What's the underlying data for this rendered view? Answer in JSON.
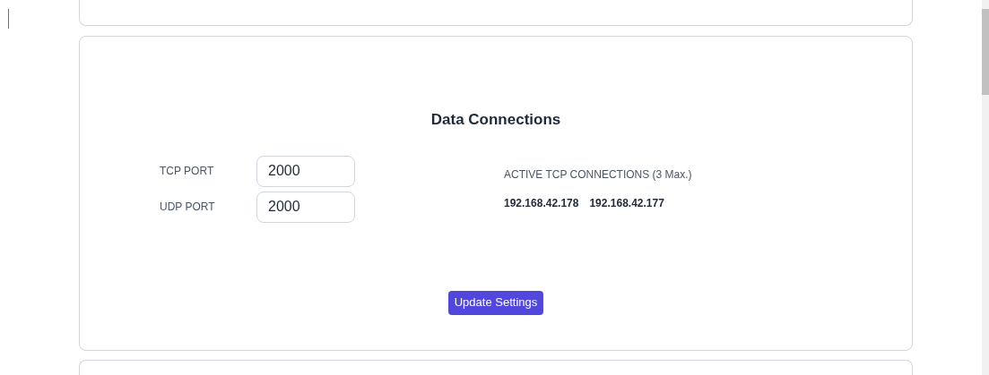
{
  "section": {
    "title": "Data Connections",
    "fields": [
      {
        "label": "TCP PORT",
        "value": "2000"
      },
      {
        "label": "UDP PORT",
        "value": "2000"
      }
    ],
    "connections": {
      "heading": "ACTIVE TCP CONNECTIONS (3 Max.)",
      "addresses": [
        "192.168.42.178",
        "192.168.42.177"
      ]
    },
    "button": "Update Settings"
  }
}
